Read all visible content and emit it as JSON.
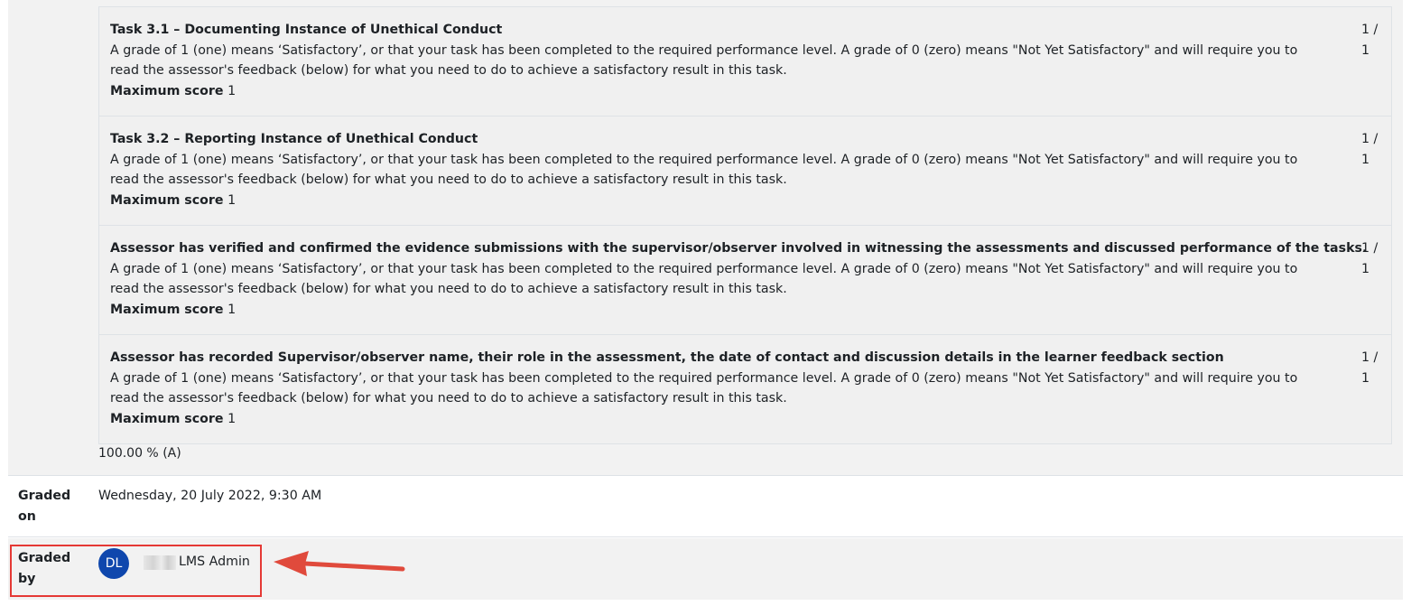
{
  "criteria": [
    {
      "title": "Task 3.1 – Documenting Instance of Unethical Conduct",
      "description": "A grade of 1 (one) means ‘Satisfactory’, or that your task has been completed to the required performance level. A grade of 0 (zero) means \"Not Yet Satisfactory\" and will require you to read the assessor's feedback (below) for what you need to do to achieve a satisfactory result in this task.",
      "max_score_label": "Maximum score",
      "max_score_value": "1",
      "score_line1": "1 /",
      "score_line2": "1"
    },
    {
      "title": "Task 3.2 – Reporting Instance of Unethical Conduct",
      "description": "A grade of 1 (one) means ‘Satisfactory’, or that your task has been completed to the required performance level. A grade of 0 (zero) means \"Not Yet Satisfactory\" and will require you to read the assessor's feedback (below) for what you need to do to achieve a satisfactory result in this task.",
      "max_score_label": "Maximum score",
      "max_score_value": "1",
      "score_line1": "1 /",
      "score_line2": "1"
    },
    {
      "title": "Assessor has verified and confirmed the evidence submissions with the supervisor/observer involved in witnessing the assessments and discussed performance of the tasks.",
      "description": "A grade of 1 (one) means ‘Satisfactory’, or that your task has been completed to the required performance level. A grade of 0 (zero) means \"Not Yet Satisfactory\" and will require you to read the assessor's feedback (below) for what you need to do to achieve a satisfactory result in this task.",
      "max_score_label": "Maximum score",
      "max_score_value": "1",
      "score_line1": "1 /",
      "score_line2": "1"
    },
    {
      "title": "Assessor has recorded Supervisor/observer name, their role in the assessment, the date of contact and discussion details in the learner feedback section",
      "description": "A grade of 1 (one) means ‘Satisfactory’, or that your task has been completed to the required performance level. A grade of 0 (zero) means \"Not Yet Satisfactory\" and will require you to read the assessor's feedback (below) for what you need to do to achieve a satisfactory result in this task.",
      "max_score_label": "Maximum score",
      "max_score_value": "1",
      "score_line1": "1 /",
      "score_line2": "1"
    }
  ],
  "overall_grade": "100.00 % (A)",
  "graded_on": {
    "label": "Graded on",
    "value": "Wednesday, 20 July 2022, 9:30 AM"
  },
  "graded_by": {
    "label": "Graded by",
    "avatar_initials": "DL",
    "name": "LMS Admin"
  },
  "colors": {
    "avatar": "#0f47ad",
    "highlight": "#e53935"
  }
}
